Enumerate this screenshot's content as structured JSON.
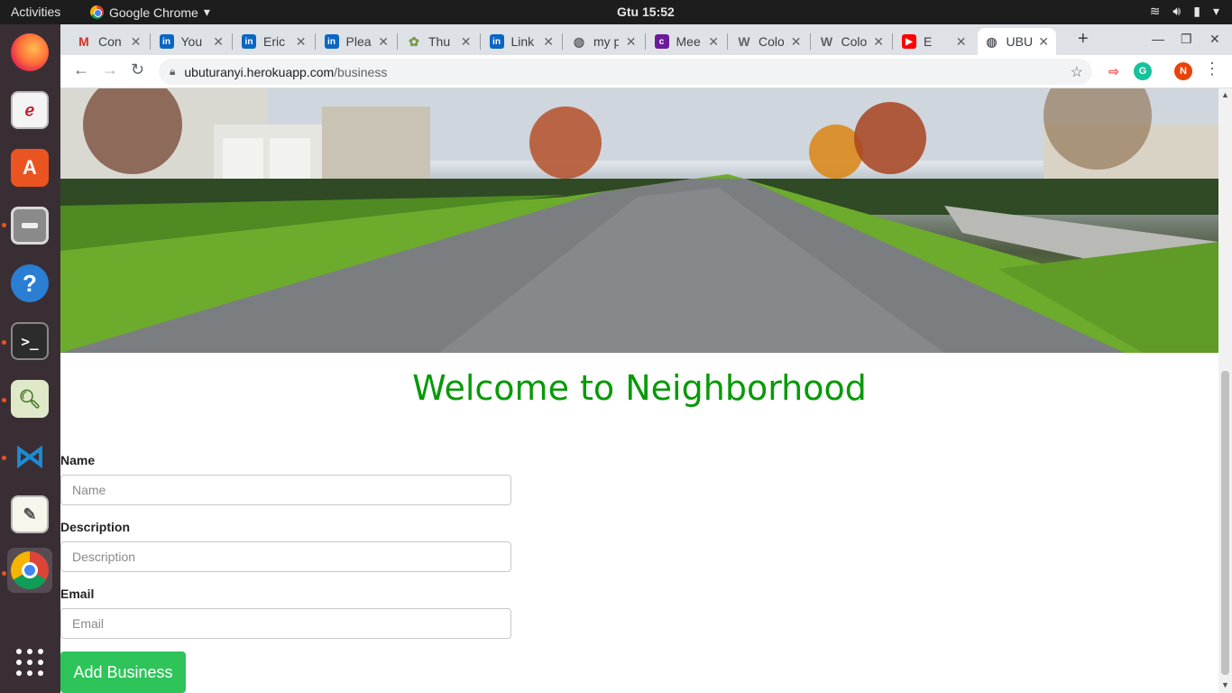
{
  "system": {
    "activities": "Activities",
    "app_menu": "Google Chrome",
    "clock": "Gtu 15:52"
  },
  "dock": {
    "items": [
      {
        "name": "firefox"
      },
      {
        "name": "document-viewer"
      },
      {
        "name": "software-center"
      },
      {
        "name": "files"
      },
      {
        "name": "help"
      },
      {
        "name": "terminal"
      },
      {
        "name": "image-viewer"
      },
      {
        "name": "vscode"
      },
      {
        "name": "text-editor"
      },
      {
        "name": "chrome"
      }
    ]
  },
  "tabs": [
    {
      "title": "Con",
      "icon": "gmail-icon",
      "color": "#d93025"
    },
    {
      "title": "You",
      "icon": "linkedin-icon",
      "color": "#0a66c2"
    },
    {
      "title": "Eric",
      "icon": "linkedin-icon",
      "color": "#0a66c2"
    },
    {
      "title": "Plea",
      "icon": "linkedin-icon",
      "color": "#0a66c2"
    },
    {
      "title": "Thu",
      "icon": "tree-icon",
      "color": "#7a9a4a"
    },
    {
      "title": "Link",
      "icon": "linkedin-icon",
      "color": "#0a66c2"
    },
    {
      "title": "my p",
      "icon": "globe-icon",
      "color": "#5f6368"
    },
    {
      "title": "Mee",
      "icon": "colorlib-icon",
      "color": "#6a1b9a"
    },
    {
      "title": "Colo",
      "icon": "wordpress-icon",
      "color": "#5f6368"
    },
    {
      "title": "Colo",
      "icon": "wordpress-icon",
      "color": "#5f6368"
    },
    {
      "title": "E",
      "icon": "youtube-icon",
      "color": "#ff0000"
    },
    {
      "title": "UBU",
      "icon": "globe-icon",
      "color": "#5f6368"
    }
  ],
  "address": {
    "host": "ubuturanyi.herokuapp.com",
    "path": "/business"
  },
  "profile_initial": "N",
  "page": {
    "title": "Welcome to Neighborhood",
    "form": {
      "name_label": "Name",
      "name_placeholder": "Name",
      "description_label": "Description",
      "description_placeholder": "Description",
      "email_label": "Email",
      "email_placeholder": "Email",
      "submit_label": "Add Business"
    }
  },
  "colors": {
    "title_green": "#079a07",
    "button_green": "#2ec45a"
  }
}
